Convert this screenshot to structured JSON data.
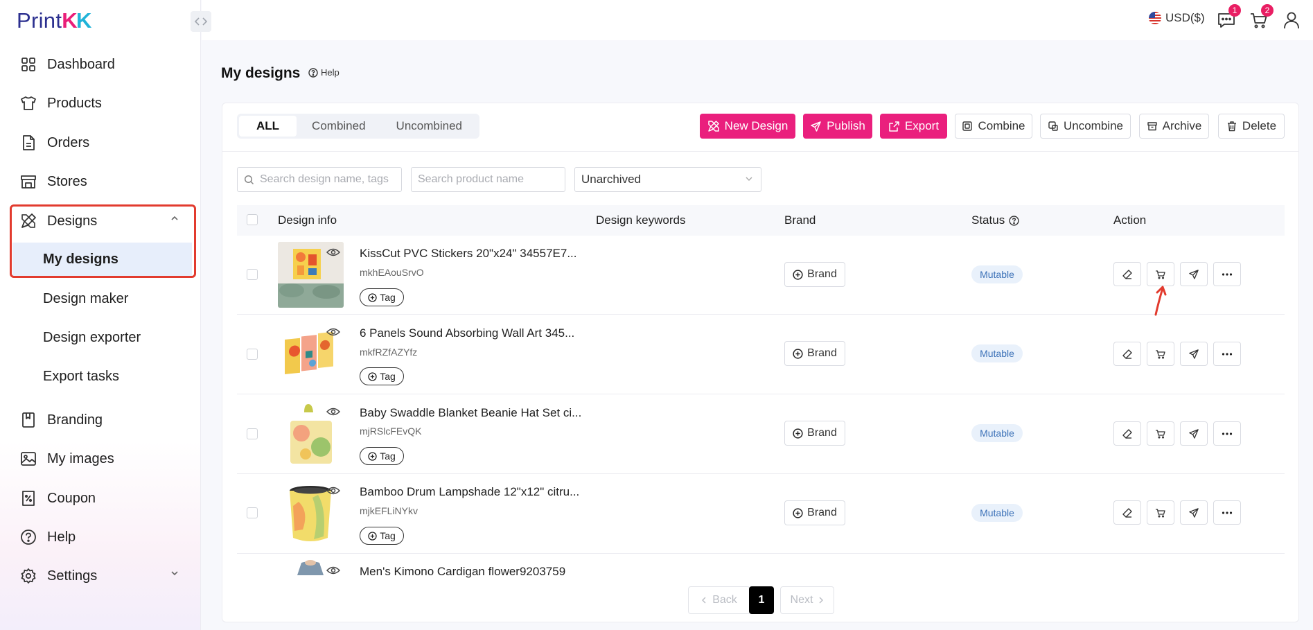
{
  "app": {
    "logo_a": "Print",
    "logo_b": "K",
    "logo_c": "K"
  },
  "sidebar": {
    "items": [
      {
        "label": "Dashboard",
        "icon": "dashboard-grid-icon"
      },
      {
        "label": "Products",
        "icon": "tshirt-icon"
      },
      {
        "label": "Orders",
        "icon": "document-icon"
      },
      {
        "label": "Stores",
        "icon": "store-icon"
      },
      {
        "label": "Designs",
        "icon": "design-tools-icon"
      }
    ],
    "design_sub": [
      "My designs",
      "Design maker",
      "Design exporter",
      "Export tasks"
    ],
    "items2": [
      {
        "label": "Branding",
        "icon": "book-icon"
      },
      {
        "label": "My images",
        "icon": "image-icon"
      },
      {
        "label": "Coupon",
        "icon": "coupon-icon"
      },
      {
        "label": "Help",
        "icon": "question-icon"
      },
      {
        "label": "Settings",
        "icon": "gear-icon"
      }
    ]
  },
  "topbar": {
    "currency": "USD($)",
    "messages_badge": "1",
    "cart_badge": "2"
  },
  "page": {
    "title": "My designs",
    "help": "Help"
  },
  "tabs": [
    "ALL",
    "Combined",
    "Uncombined"
  ],
  "toolbar": {
    "new_design": "New Design",
    "publish": "Publish",
    "export": "Export",
    "combine": "Combine",
    "uncombine": "Uncombine",
    "archive": "Archive",
    "delete": "Delete"
  },
  "filters": {
    "search_design_placeholder": "Search design name, tags",
    "search_product_placeholder": "Search product name",
    "archive_select": "Unarchived"
  },
  "table": {
    "headers": {
      "design_info": "Design info",
      "design_keywords": "Design keywords",
      "brand": "Brand",
      "status": "Status",
      "action": "Action"
    },
    "tag_label": "Tag",
    "brand_label": "Brand",
    "rows": [
      {
        "name": "KissCut PVC Stickers 20\"x24\" 34557E7...",
        "code": "mkhEAouSrvO",
        "status": "Mutable"
      },
      {
        "name": "6 Panels Sound Absorbing Wall Art 345...",
        "code": "mkfRZfAZYfz",
        "status": "Mutable"
      },
      {
        "name": "Baby Swaddle Blanket Beanie Hat Set ci...",
        "code": "mjRSlcFEvQK",
        "status": "Mutable"
      },
      {
        "name": "Bamboo Drum Lampshade 12\"x12\" citru...",
        "code": "mjkEFLiNYkv",
        "status": "Mutable"
      },
      {
        "name": "Men's Kimono Cardigan flower9203759",
        "code": "",
        "status": ""
      }
    ]
  },
  "pagination": {
    "back": "Back",
    "current": "1",
    "next": "Next"
  },
  "colors": {
    "accent": "#ea1f7d",
    "highlight": "#e23b2e",
    "active_bg": "#e7eefb"
  }
}
